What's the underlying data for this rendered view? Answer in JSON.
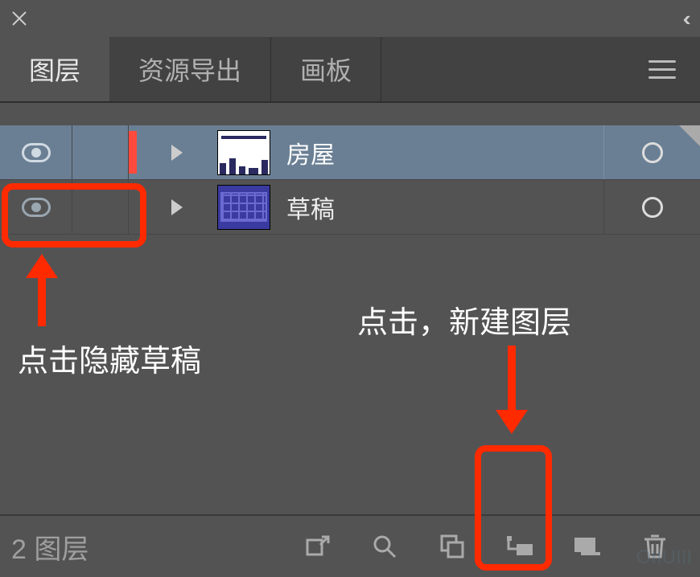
{
  "topbar": {
    "close_glyph": "✕",
    "collapse_glyph": "‹‹"
  },
  "tabs": {
    "items": [
      {
        "label": "图层",
        "active": true
      },
      {
        "label": "资源导出",
        "active": false
      },
      {
        "label": "画板",
        "active": false
      }
    ]
  },
  "layers": {
    "rows": [
      {
        "name": "房屋",
        "visible": true,
        "selected": true,
        "color": "#ff4a3d",
        "thumb": "buildings"
      },
      {
        "name": "草稿",
        "visible": true,
        "selected": false,
        "color": "#6a6a6a",
        "thumb": "blueprint"
      }
    ]
  },
  "bottombar": {
    "count_label": "2 图层",
    "icons": [
      "export-icon",
      "search-icon",
      "group-icon",
      "sublayer-icon",
      "new-layer-icon",
      "delete-icon"
    ]
  },
  "annotations": {
    "hide_draft_tip": "点击隐藏草稿",
    "new_layer_tip": "点击，新建图层"
  },
  "watermark": "OIIUIII"
}
